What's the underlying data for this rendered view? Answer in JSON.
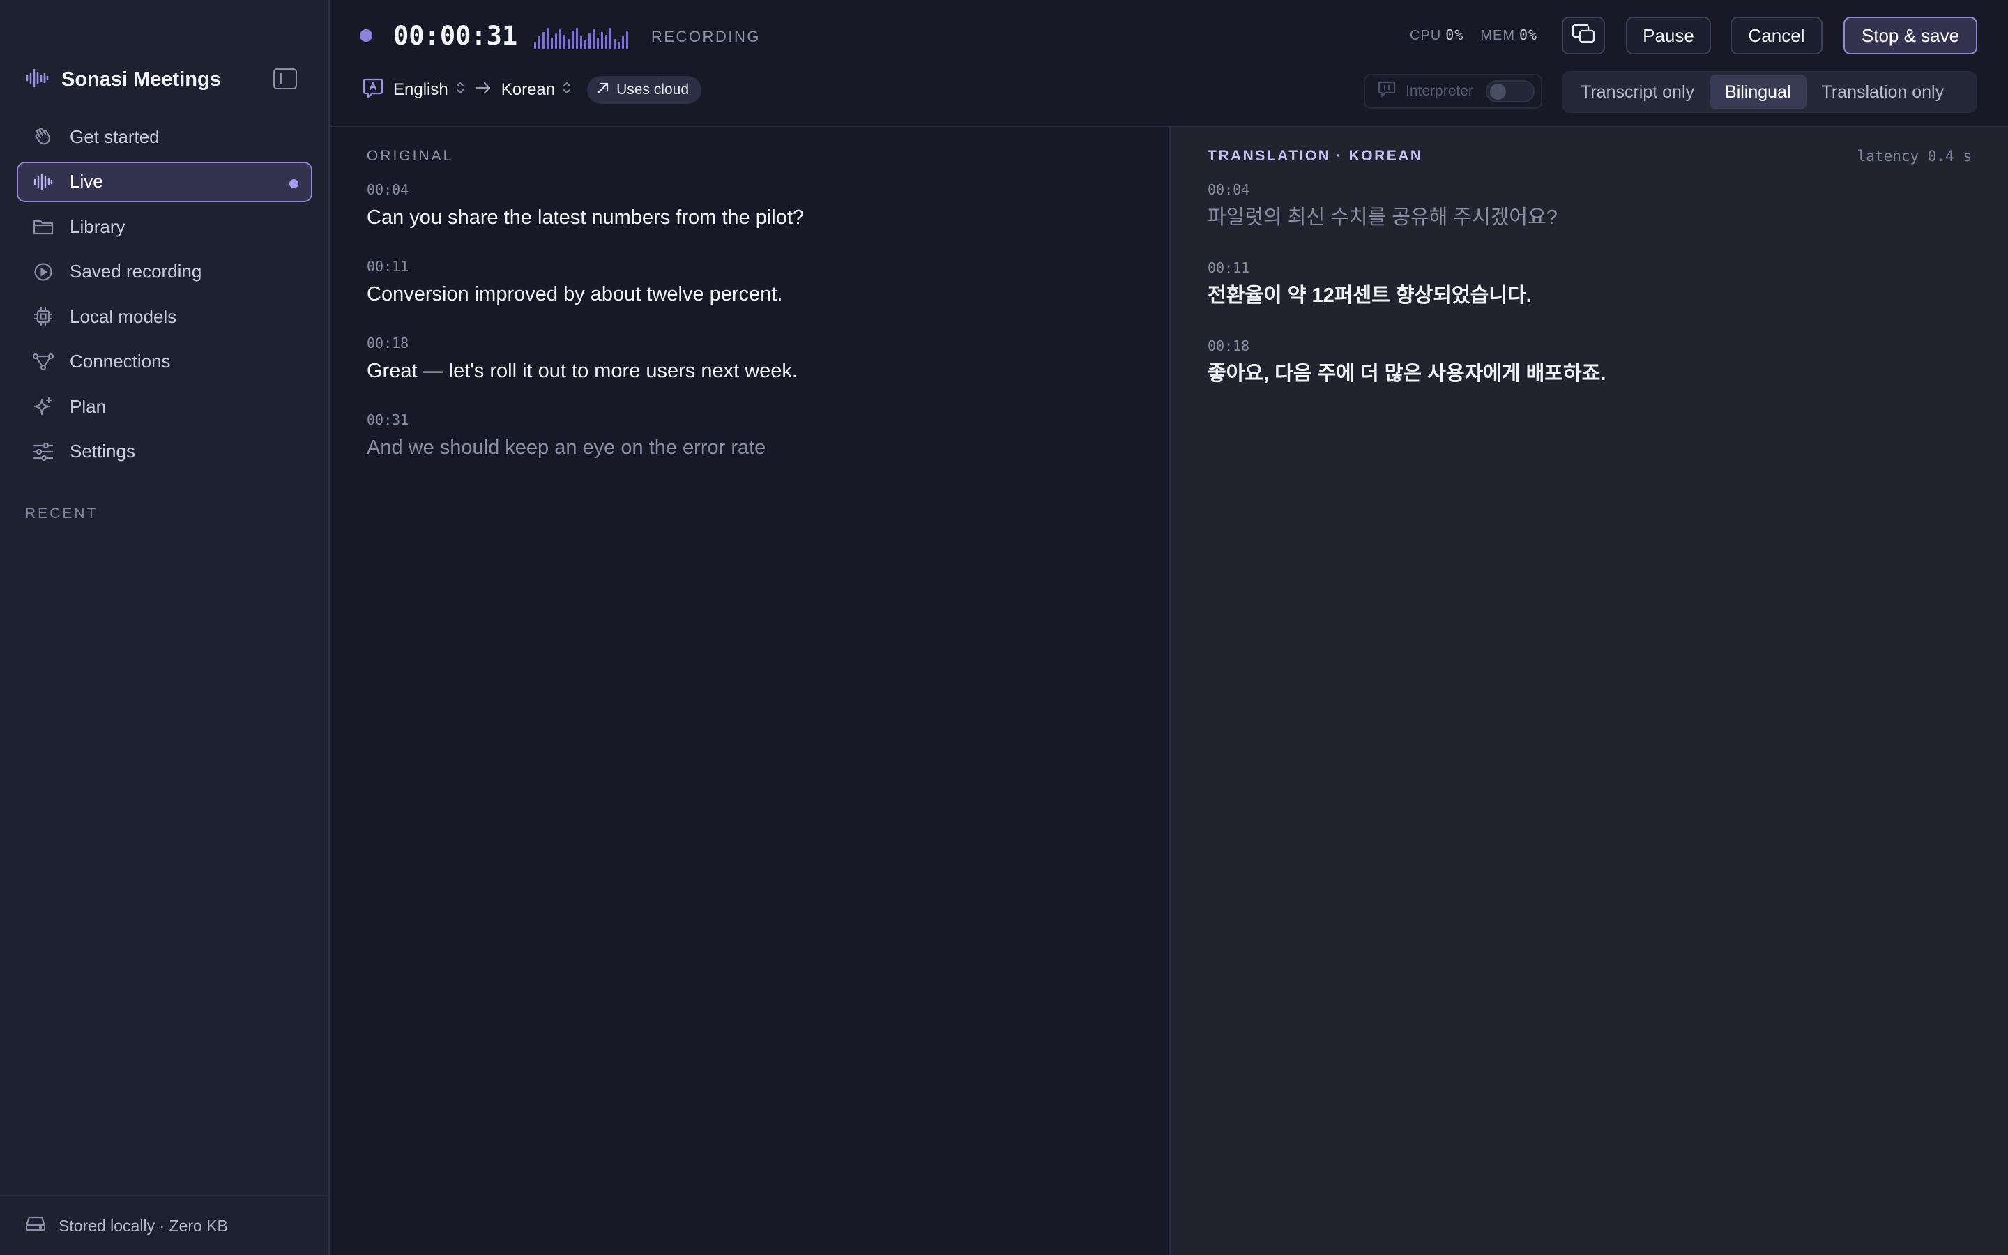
{
  "app": {
    "title": "Sonasi Meetings",
    "brand_color": "#9a8fe6"
  },
  "sidebar": {
    "items": [
      {
        "label": "Get started",
        "icon": "wave-hand-icon"
      },
      {
        "label": "Live",
        "icon": "waveform-icon",
        "active": true
      },
      {
        "label": "Library",
        "icon": "folder-icon"
      },
      {
        "label": "Saved recording",
        "icon": "play-circle-icon"
      },
      {
        "label": "Local models",
        "icon": "chip-icon"
      },
      {
        "label": "Connections",
        "icon": "network-icon"
      },
      {
        "label": "Plan",
        "icon": "sparkle-icon"
      },
      {
        "label": "Settings",
        "icon": "sliders-icon"
      }
    ],
    "recent_label": "RECENT",
    "footer": "Stored locally · Zero KB"
  },
  "recording": {
    "timer": "00:00:31",
    "status": "RECORDING"
  },
  "stats": {
    "cpu_label": "CPU",
    "cpu_value": "0%",
    "mem_label": "MEM",
    "mem_value": "0%"
  },
  "buttons": {
    "pause": "Pause",
    "cancel": "Cancel",
    "stop_save": "Stop & save"
  },
  "languages": {
    "source": "English",
    "target": "Korean",
    "cloud_chip": "Uses cloud"
  },
  "interpreter": {
    "label": "Interpreter",
    "enabled": false
  },
  "view_modes": {
    "options": [
      "Transcript only",
      "Bilingual",
      "Translation only"
    ],
    "selected": "Bilingual"
  },
  "original": {
    "label": "ORIGINAL",
    "segments": [
      {
        "time": "00:04",
        "text": "Can you share the latest numbers from the pilot?"
      },
      {
        "time": "00:11",
        "text": "Conversion improved by about twelve percent."
      },
      {
        "time": "00:18",
        "text": "Great — let's roll it out to more users next week."
      },
      {
        "time": "00:31",
        "text": "And we should keep an eye on the error rate"
      }
    ]
  },
  "translation": {
    "label": "TRANSLATION · KOREAN",
    "latency": "latency 0.4 s",
    "segments": [
      {
        "time": "00:04",
        "text": "파일럿의 최신 수치를 공유해 주시겠어요?"
      },
      {
        "time": "00:11",
        "text": "전환율이 약 12퍼센트 향상되었습니다."
      },
      {
        "time": "00:18",
        "text": "좋아요, 다음 주에 더 많은 사용자에게 배포하죠."
      }
    ]
  }
}
